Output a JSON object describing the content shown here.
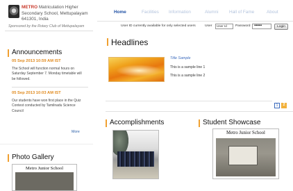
{
  "school": {
    "brand": "METRO",
    "name_rest": " Matriculation Higher Secondary School, Mettupalayam 641301, India",
    "sponsor": "Sponsored by the Rotary Club of Mettupalayam"
  },
  "nav": {
    "items": [
      {
        "label": "Home",
        "active": true
      },
      {
        "label": "Facilities",
        "active": false
      },
      {
        "label": "Information",
        "active": false
      },
      {
        "label": "Alumni",
        "active": false
      },
      {
        "label": "Hall of Fame",
        "active": false
      },
      {
        "label": "About",
        "active": false
      }
    ]
  },
  "login": {
    "notice": "User ID currently available for only selected users",
    "user_label": "User",
    "user_value": "User Id",
    "password_label": "Password",
    "password_value": "••••••••",
    "button": "Login"
  },
  "announcements": {
    "title": "Announcements",
    "items": [
      {
        "date": "05 Sep 2013 10:59 AM IST",
        "text": "The School will function normal hours on Saturday September 7. Monday timetable will be followed."
      },
      {
        "date": "05 Sep 2013 10:03 AM IST",
        "text": "Our students have won first place in the Quiz Contest conducted by Tamilnadu Science Council"
      }
    ],
    "more": "More"
  },
  "gallery": {
    "title": "Photo Gallery",
    "caption": "Metro Junior School"
  },
  "headlines": {
    "title": "Headlines",
    "item_title": "Title Sample",
    "lines": [
      "This is a sample line 1",
      "This is a sample line 2"
    ],
    "pages": [
      "1",
      "2"
    ]
  },
  "accomplishments": {
    "title": "Accomplishments"
  },
  "showcase": {
    "title": "Student Showcase",
    "caption": "Metro Junior School"
  },
  "colors": {
    "accent": "#f0a030",
    "date": "#e08a1e",
    "nav_active": "#1d4fa3",
    "link": "#3c6bbd"
  }
}
